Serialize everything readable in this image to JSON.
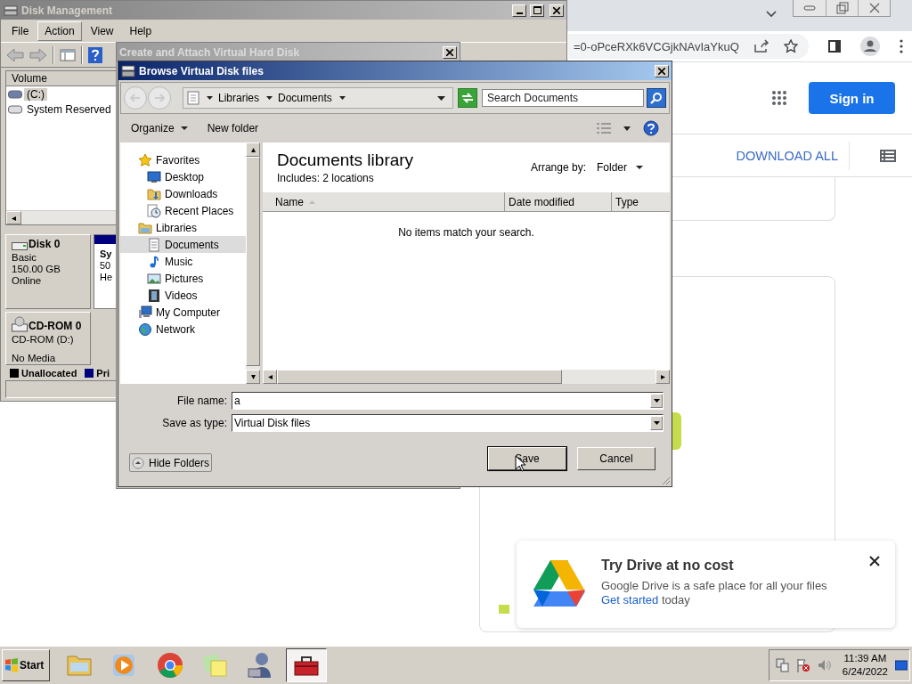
{
  "browser": {
    "url": "=0-oPceRXk6VCGjkNAvIaYkuQ",
    "sign_in": "Sign in",
    "download_all": "DOWNLOAD ALL"
  },
  "disk_management": {
    "title": "Disk Management",
    "menu": [
      {
        "label": "File",
        "selected": false
      },
      {
        "label": "Action",
        "selected": true
      },
      {
        "label": "View",
        "selected": false
      },
      {
        "label": "Help",
        "selected": false
      }
    ],
    "volume_column": "Volume",
    "volumes": [
      {
        "name": "(C:)",
        "selected": true
      },
      {
        "name": "System Reserved",
        "selected": false
      }
    ],
    "disks": [
      {
        "name": "Disk 0",
        "kind": "hard_disk",
        "type": "Basic",
        "size": "150.00 GB",
        "status": "Online"
      },
      {
        "name": "CD-ROM 0",
        "kind": "cdrom",
        "type": "CD-ROM (D:)",
        "status": "No Media"
      }
    ],
    "partition": {
      "name": "Sy",
      "size": "50",
      "status": "He"
    },
    "legend": [
      {
        "label": "Unallocated",
        "color": "#000000"
      },
      {
        "label": "Pri",
        "color": "#00007f"
      }
    ]
  },
  "scroll_arrows": {
    "left": "◂",
    "up": "▴",
    "down": "▾",
    "right": "▸"
  },
  "create_dialog": {
    "title": "Create and Attach Virtual Hard Disk"
  },
  "browse_dialog": {
    "title": "Browse Virtual Disk files",
    "breadcrumb": [
      "Libraries",
      "Documents"
    ],
    "search": {
      "placeholder": "Search Documents"
    },
    "organize": "Organize",
    "new_folder": "New folder",
    "nav": [
      {
        "label": "Favorites",
        "kind": "favorites",
        "selected": false,
        "children": [
          {
            "label": "Desktop",
            "kind": "desktop",
            "selected": false
          },
          {
            "label": "Downloads",
            "kind": "downloads",
            "selected": false
          },
          {
            "label": "Recent Places",
            "kind": "recent",
            "selected": false
          }
        ]
      },
      {
        "label": "Libraries",
        "kind": "libraries",
        "selected": false,
        "children": [
          {
            "label": "Documents",
            "kind": "documents",
            "selected": true
          },
          {
            "label": "Music",
            "kind": "music",
            "selected": false
          },
          {
            "label": "Pictures",
            "kind": "pictures",
            "selected": false
          },
          {
            "label": "Videos",
            "kind": "videos",
            "selected": false
          }
        ]
      },
      {
        "label": "My Computer",
        "kind": "computer",
        "selected": false
      },
      {
        "label": "Network",
        "kind": "network",
        "selected": false
      }
    ],
    "library": {
      "title": "Documents library",
      "includes": "Includes:  2 locations",
      "arrange_label": "Arrange by:",
      "arrange_value": "Folder"
    },
    "columns": [
      {
        "label": "Name",
        "sorted": true
      },
      {
        "label": "Date modified",
        "sorted": false
      },
      {
        "label": "Type",
        "sorted": false
      }
    ],
    "empty_message": "No items match your search.",
    "file_name": {
      "label": "File name:",
      "value": "a"
    },
    "save_type": {
      "label": "Save as type:",
      "value": "Virtual Disk files"
    },
    "hide_folders": "Hide Folders",
    "save": "Save",
    "cancel": "Cancel"
  },
  "drive_promo": {
    "title": "Try Drive at no cost",
    "text": "Google Drive is a safe place for all your files",
    "link": "Get started",
    "link_after": "today"
  },
  "taskbar": {
    "start": "Start",
    "apps": [
      {
        "kind": "folder",
        "selected": false
      },
      {
        "kind": "media",
        "selected": false
      },
      {
        "kind": "browser",
        "selected": false
      },
      {
        "kind": "notes",
        "selected": false
      },
      {
        "kind": "user",
        "selected": false
      },
      {
        "kind": "toolbox",
        "selected": true
      }
    ],
    "time": "11:39 AM",
    "date": "6/24/2022"
  }
}
